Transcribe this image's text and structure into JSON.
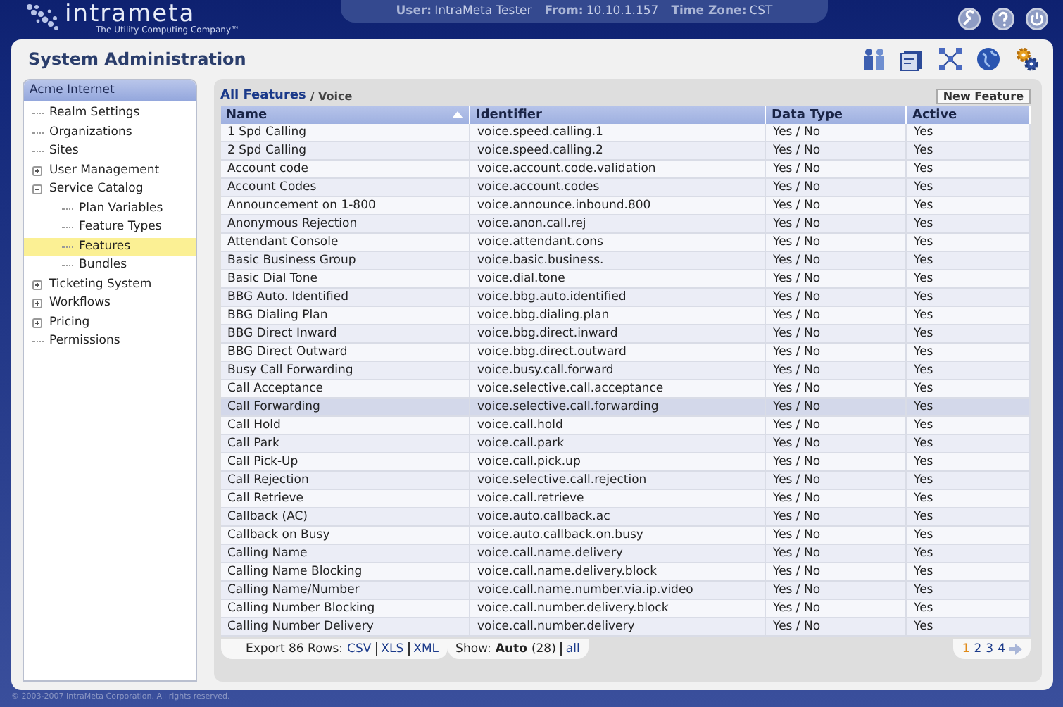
{
  "brand": {
    "name": "intrameta",
    "tagline": "The Utility Computing Company™"
  },
  "session": [
    {
      "label": "User:",
      "value": "IntraMeta Tester"
    },
    {
      "label": "From:",
      "value": "10.10.1.157"
    },
    {
      "label": "Time Zone:",
      "value": "CST"
    }
  ],
  "page_title": "System Administration",
  "sidebar": {
    "title": "Acme Internet",
    "items": [
      {
        "label": "Realm Settings",
        "selected": false
      },
      {
        "label": "Organizations",
        "selected": false
      },
      {
        "label": "Sites",
        "selected": false
      },
      {
        "label": "User Management",
        "kind": "group",
        "selected": false,
        "expanded": false
      },
      {
        "label": "Service Catalog",
        "kind": "group",
        "selected": false,
        "expanded": true,
        "children": [
          {
            "label": "Plan Variables",
            "selected": false
          },
          {
            "label": "Feature Types",
            "selected": false
          },
          {
            "label": "Features",
            "selected": true
          },
          {
            "label": "Bundles",
            "selected": false
          }
        ]
      },
      {
        "label": "Ticketing System",
        "kind": "group",
        "selected": false,
        "expanded": false
      },
      {
        "label": "Workflows",
        "kind": "group",
        "selected": false,
        "expanded": false
      },
      {
        "label": "Pricing",
        "kind": "group",
        "selected": false,
        "expanded": false
      },
      {
        "label": "Permissions",
        "selected": false
      }
    ]
  },
  "breadcrumb": {
    "link": "All Features",
    "current": "/ Voice"
  },
  "new_button": "New Feature",
  "table": {
    "columns": [
      {
        "label": "Name",
        "sorted": true
      },
      {
        "label": "Identifier",
        "sorted": false
      },
      {
        "label": "Data Type",
        "sorted": false
      },
      {
        "label": "Active",
        "sorted": false
      }
    ],
    "rows": [
      {
        "cells": [
          "1 Spd Calling",
          "voice.speed.calling.1",
          "Yes / No",
          "Yes"
        ],
        "selected": false
      },
      {
        "cells": [
          "2 Spd Calling",
          "voice.speed.calling.2",
          "Yes / No",
          "Yes"
        ],
        "selected": false
      },
      {
        "cells": [
          "Account code",
          "voice.account.code.validation",
          "Yes / No",
          "Yes"
        ],
        "selected": false
      },
      {
        "cells": [
          "Account Codes",
          "voice.account.codes",
          "Yes / No",
          "Yes"
        ],
        "selected": false
      },
      {
        "cells": [
          "Announcement on 1-800",
          "voice.announce.inbound.800",
          "Yes / No",
          "Yes"
        ],
        "selected": false
      },
      {
        "cells": [
          "Anonymous Rejection",
          "voice.anon.call.rej",
          "Yes / No",
          "Yes"
        ],
        "selected": false
      },
      {
        "cells": [
          "Attendant Console",
          "voice.attendant.cons",
          "Yes / No",
          "Yes"
        ],
        "selected": false
      },
      {
        "cells": [
          "Basic Business Group",
          "voice.basic.business.",
          "Yes / No",
          "Yes"
        ],
        "selected": false
      },
      {
        "cells": [
          "Basic Dial Tone",
          "voice.dial.tone",
          "Yes / No",
          "Yes"
        ],
        "selected": false
      },
      {
        "cells": [
          "BBG Auto. Identified",
          "voice.bbg.auto.identified",
          "Yes / No",
          "Yes"
        ],
        "selected": false
      },
      {
        "cells": [
          "BBG Dialing Plan",
          "voice.bbg.dialing.plan",
          "Yes / No",
          "Yes"
        ],
        "selected": false
      },
      {
        "cells": [
          "BBG Direct Inward",
          "voice.bbg.direct.inward",
          "Yes / No",
          "Yes"
        ],
        "selected": false
      },
      {
        "cells": [
          "BBG Direct Outward",
          "voice.bbg.direct.outward",
          "Yes / No",
          "Yes"
        ],
        "selected": false
      },
      {
        "cells": [
          "Busy Call Forwarding",
          "voice.busy.call.forward",
          "Yes / No",
          "Yes"
        ],
        "selected": false
      },
      {
        "cells": [
          "Call Acceptance",
          "voice.selective.call.acceptance",
          "Yes / No",
          "Yes"
        ],
        "selected": false
      },
      {
        "cells": [
          "Call Forwarding",
          "voice.selective.call.forwarding",
          "Yes / No",
          "Yes"
        ],
        "selected": true
      },
      {
        "cells": [
          "Call Hold",
          "voice.call.hold",
          "Yes / No",
          "Yes"
        ],
        "selected": false
      },
      {
        "cells": [
          "Call Park",
          "voice.call.park",
          "Yes / No",
          "Yes"
        ],
        "selected": false
      },
      {
        "cells": [
          "Call Pick-Up",
          "voice.call.pick.up",
          "Yes / No",
          "Yes"
        ],
        "selected": false
      },
      {
        "cells": [
          "Call Rejection",
          "voice.selective.call.rejection",
          "Yes / No",
          "Yes"
        ],
        "selected": false
      },
      {
        "cells": [
          "Call Retrieve",
          "voice.call.retrieve",
          "Yes / No",
          "Yes"
        ],
        "selected": false
      },
      {
        "cells": [
          "Callback (AC)",
          "voice.auto.callback.ac",
          "Yes / No",
          "Yes"
        ],
        "selected": false
      },
      {
        "cells": [
          "Callback on Busy",
          "voice.auto.callback.on.busy",
          "Yes / No",
          "Yes"
        ],
        "selected": false
      },
      {
        "cells": [
          "Calling Name",
          "voice.call.name.delivery",
          "Yes / No",
          "Yes"
        ],
        "selected": false
      },
      {
        "cells": [
          "Calling Name Blocking",
          "voice.call.name.delivery.block",
          "Yes / No",
          "Yes"
        ],
        "selected": false
      },
      {
        "cells": [
          "Calling Name/Number",
          "voice.call.name.number.via.ip.video",
          "Yes / No",
          "Yes"
        ],
        "selected": false
      },
      {
        "cells": [
          "Calling Number Blocking",
          "voice.call.number.delivery.block",
          "Yes / No",
          "Yes"
        ],
        "selected": false
      },
      {
        "cells": [
          "Calling Number Delivery",
          "voice.call.number.delivery",
          "Yes / No",
          "Yes"
        ],
        "selected": false
      }
    ]
  },
  "export": {
    "label": "Export 86 Rows:",
    "formats": [
      "CSV",
      "XLS",
      "XML"
    ]
  },
  "show": {
    "label": "Show:",
    "mode": "Auto",
    "count": "(28)",
    "all": "all"
  },
  "pages": [
    {
      "label": "1",
      "selected": true
    },
    {
      "label": "2",
      "selected": false
    },
    {
      "label": "3",
      "selected": false
    },
    {
      "label": "4",
      "selected": false
    }
  ],
  "copyright": "© 2003-2007 IntraMeta Corporation.  All rights reserved."
}
